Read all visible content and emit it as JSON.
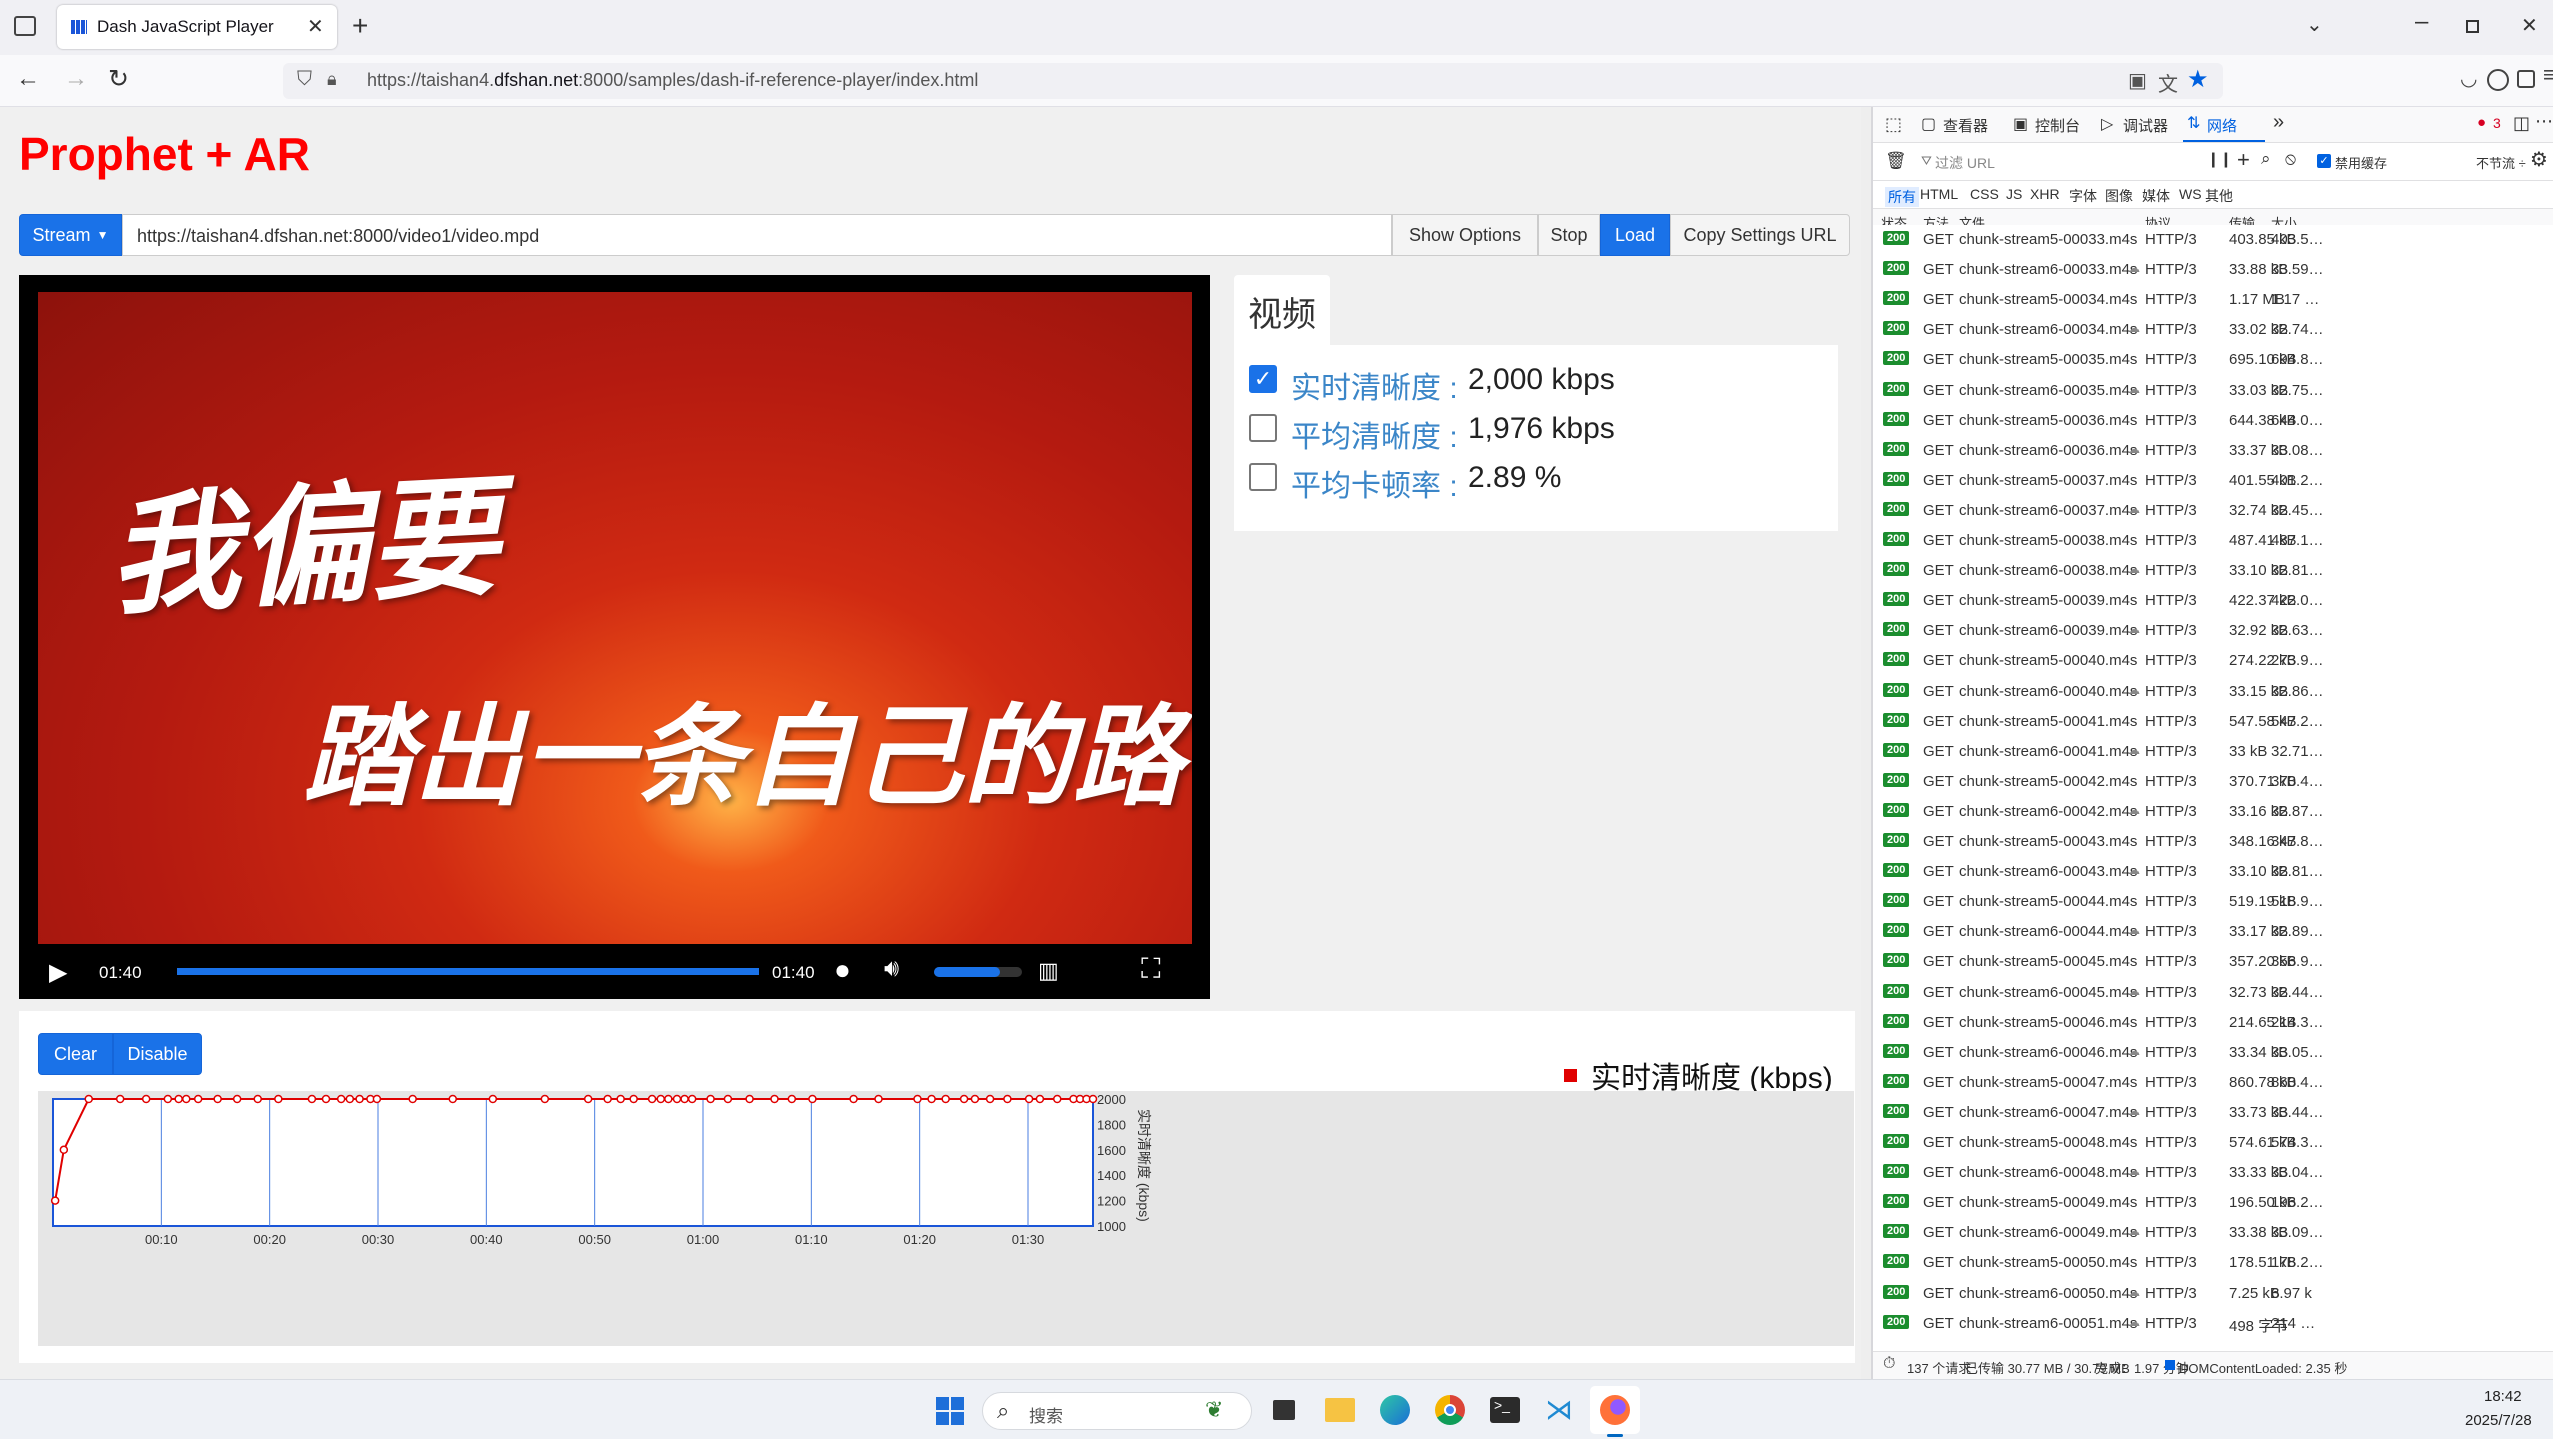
{
  "browser": {
    "tab_title": "Dash JavaScript Player",
    "url_prefix": "https://taishan4.",
    "url_domain": "dfshan.net",
    "url_rest": ":8000/samples/dash-if-reference-player/index.html"
  },
  "page": {
    "title": "Prophet + AR",
    "stream_button": "Stream",
    "stream_url": "https://taishan4.dfshan.net:8000/video1/video.mpd",
    "show_options": "Show Options",
    "stop": "Stop",
    "load": "Load",
    "copy_settings": "Copy Settings URL"
  },
  "video": {
    "line1": "我偏要",
    "line2": "踏出一条自己的路",
    "time_current": "01:40",
    "time_total": "01:40",
    "progress": 1.0,
    "volume": 0.75
  },
  "metrics": {
    "tab": "视频",
    "items": [
      {
        "label": "实时清晰度 :",
        "value": "2,000 kbps",
        "checked": true
      },
      {
        "label": "平均清晰度 :",
        "value": "1,976 kbps",
        "checked": false
      },
      {
        "label": "平均卡顿率 :",
        "value": "2.89 %",
        "checked": false
      }
    ]
  },
  "chart_controls": {
    "clear": "Clear",
    "disable": "Disable"
  },
  "chart_data": {
    "type": "line",
    "legend": "实时清晰度 (kbps)",
    "ylabel": "实时清晰度 (kbps)",
    "ylim": [
      1000,
      2000
    ],
    "yticks": [
      "2000",
      "1800",
      "1600",
      "1400",
      "1200",
      "1000"
    ],
    "xticks": [
      "00:10",
      "00:20",
      "00:30",
      "00:40",
      "00:50",
      "01:00",
      "01:10",
      "01:20",
      "01:30"
    ],
    "xlim": [
      0,
      96
    ],
    "color": "#e00000",
    "x": [
      0.2,
      1,
      3.3,
      6.2,
      8.6,
      10.6,
      11.6,
      12.3,
      13.4,
      15.2,
      17,
      18.9,
      20.8,
      23.9,
      25.2,
      26.6,
      27.4,
      28.3,
      29.3,
      29.9,
      33.2,
      36.9,
      40.6,
      45.4,
      49.4,
      51.2,
      52.4,
      53.6,
      55.3,
      56.1,
      56.8,
      57.6,
      58.3,
      59,
      60.7,
      62.3,
      64.3,
      66.6,
      68.2,
      70.1,
      73.9,
      76.2,
      79.8,
      81.1,
      82.4,
      84.1,
      85.1,
      86.5,
      88.1,
      90.1,
      91.1,
      92.7,
      94.2,
      94.8,
      95.4,
      96
    ],
    "values": [
      1200,
      1600,
      2000,
      2000,
      2000,
      2000,
      2000,
      2000,
      2000,
      2000,
      2000,
      2000,
      2000,
      2000,
      2000,
      2000,
      2000,
      2000,
      2000,
      2000,
      2000,
      2000,
      2000,
      2000,
      2000,
      2000,
      2000,
      2000,
      2000,
      2000,
      2000,
      2000,
      2000,
      2000,
      2000,
      2000,
      2000,
      2000,
      2000,
      2000,
      2000,
      2000,
      2000,
      2000,
      2000,
      2000,
      2000,
      2000,
      2000,
      2000,
      2000,
      2000,
      2000,
      2000,
      2000,
      2000
    ]
  },
  "devtools": {
    "tabs": [
      "查看器",
      "控制台",
      "调试器",
      "网络"
    ],
    "error_count": "3",
    "filter_placeholder": "过滤 URL",
    "disable_cache": "禁用缓存",
    "throttle": "不节流 ÷",
    "type_filters": [
      "所有",
      "HTML",
      "CSS",
      "JS",
      "XHR",
      "字体",
      "图像",
      "媒体",
      "WS",
      "其他"
    ],
    "columns": [
      "状态",
      "方法",
      "文件",
      "协议",
      "传输",
      "大小"
    ],
    "rows": [
      [
        "200",
        "GET",
        "chunk-stream5-00033.m4s",
        "HTTP/3",
        "403.85 kB",
        "403.5…"
      ],
      [
        "200",
        "GET",
        "chunk-stream6-00033.m4s",
        "HTTP/3",
        "33.88 kB",
        "33.59…"
      ],
      [
        "200",
        "GET",
        "chunk-stream5-00034.m4s",
        "HTTP/3",
        "1.17 MB",
        "1.17 …"
      ],
      [
        "200",
        "GET",
        "chunk-stream6-00034.m4s",
        "HTTP/3",
        "33.02 kB",
        "32.74…"
      ],
      [
        "200",
        "GET",
        "chunk-stream5-00035.m4s",
        "HTTP/3",
        "695.10 kB",
        "694.8…"
      ],
      [
        "200",
        "GET",
        "chunk-stream6-00035.m4s",
        "HTTP/3",
        "33.03 kB",
        "32.75…"
      ],
      [
        "200",
        "GET",
        "chunk-stream5-00036.m4s",
        "HTTP/3",
        "644.38 kB",
        "644.0…"
      ],
      [
        "200",
        "GET",
        "chunk-stream6-00036.m4s",
        "HTTP/3",
        "33.37 kB",
        "33.08…"
      ],
      [
        "200",
        "GET",
        "chunk-stream5-00037.m4s",
        "HTTP/3",
        "401.55 kB",
        "401.2…"
      ],
      [
        "200",
        "GET",
        "chunk-stream6-00037.m4s",
        "HTTP/3",
        "32.74 kB",
        "32.45…"
      ],
      [
        "200",
        "GET",
        "chunk-stream5-00038.m4s",
        "HTTP/3",
        "487.41 kB",
        "487.1…"
      ],
      [
        "200",
        "GET",
        "chunk-stream6-00038.m4s",
        "HTTP/3",
        "33.10 kB",
        "32.81…"
      ],
      [
        "200",
        "GET",
        "chunk-stream5-00039.m4s",
        "HTTP/3",
        "422.37 kB",
        "422.0…"
      ],
      [
        "200",
        "GET",
        "chunk-stream6-00039.m4s",
        "HTTP/3",
        "32.92 kB",
        "32.63…"
      ],
      [
        "200",
        "GET",
        "chunk-stream5-00040.m4s",
        "HTTP/3",
        "274.22 kB",
        "273.9…"
      ],
      [
        "200",
        "GET",
        "chunk-stream6-00040.m4s",
        "HTTP/3",
        "33.15 kB",
        "32.86…"
      ],
      [
        "200",
        "GET",
        "chunk-stream5-00041.m4s",
        "HTTP/3",
        "547.58 kB",
        "547.2…"
      ],
      [
        "200",
        "GET",
        "chunk-stream6-00041.m4s",
        "HTTP/3",
        "33 kB",
        "32.71…"
      ],
      [
        "200",
        "GET",
        "chunk-stream5-00042.m4s",
        "HTTP/3",
        "370.71 kB",
        "370.4…"
      ],
      [
        "200",
        "GET",
        "chunk-stream6-00042.m4s",
        "HTTP/3",
        "33.16 kB",
        "32.87…"
      ],
      [
        "200",
        "GET",
        "chunk-stream5-00043.m4s",
        "HTTP/3",
        "348.16 kB",
        "347.8…"
      ],
      [
        "200",
        "GET",
        "chunk-stream6-00043.m4s",
        "HTTP/3",
        "33.10 kB",
        "32.81…"
      ],
      [
        "200",
        "GET",
        "chunk-stream5-00044.m4s",
        "HTTP/3",
        "519.19 kB",
        "518.9…"
      ],
      [
        "200",
        "GET",
        "chunk-stream6-00044.m4s",
        "HTTP/3",
        "33.17 kB",
        "32.89…"
      ],
      [
        "200",
        "GET",
        "chunk-stream5-00045.m4s",
        "HTTP/3",
        "357.20 kB",
        "356.9…"
      ],
      [
        "200",
        "GET",
        "chunk-stream6-00045.m4s",
        "HTTP/3",
        "32.73 kB",
        "32.44…"
      ],
      [
        "200",
        "GET",
        "chunk-stream5-00046.m4s",
        "HTTP/3",
        "214.65 kB",
        "214.3…"
      ],
      [
        "200",
        "GET",
        "chunk-stream6-00046.m4s",
        "HTTP/3",
        "33.34 kB",
        "33.05…"
      ],
      [
        "200",
        "GET",
        "chunk-stream5-00047.m4s",
        "HTTP/3",
        "860.78 kB",
        "860.4…"
      ],
      [
        "200",
        "GET",
        "chunk-stream6-00047.m4s",
        "HTTP/3",
        "33.73 kB",
        "33.44…"
      ],
      [
        "200",
        "GET",
        "chunk-stream5-00048.m4s",
        "HTTP/3",
        "574.61 kB",
        "574.3…"
      ],
      [
        "200",
        "GET",
        "chunk-stream6-00048.m4s",
        "HTTP/3",
        "33.33 kB",
        "33.04…"
      ],
      [
        "200",
        "GET",
        "chunk-stream5-00049.m4s",
        "HTTP/3",
        "196.50 kB",
        "196.2…"
      ],
      [
        "200",
        "GET",
        "chunk-stream6-00049.m4s",
        "HTTP/3",
        "33.38 kB",
        "33.09…"
      ],
      [
        "200",
        "GET",
        "chunk-stream5-00050.m4s",
        "HTTP/3",
        "178.51 kB",
        "178.2…"
      ],
      [
        "200",
        "GET",
        "chunk-stream6-00050.m4s",
        "HTTP/3",
        "7.25 kB",
        "6.97 k"
      ],
      [
        "200",
        "GET",
        "chunk-stream6-00051.m4s",
        "HTTP/3",
        "498 字节",
        "214 …"
      ]
    ],
    "status": {
      "requests": "137 个请求",
      "transferred": "已传输 30.77 MB / 30.79 MB",
      "finish": "完成：1.97 分钟",
      "dcl": "DOMContentLoaded: 2.35 秒"
    }
  },
  "taskbar": {
    "search_placeholder": "搜索",
    "time": "18:42",
    "date": "2025/7/28"
  }
}
